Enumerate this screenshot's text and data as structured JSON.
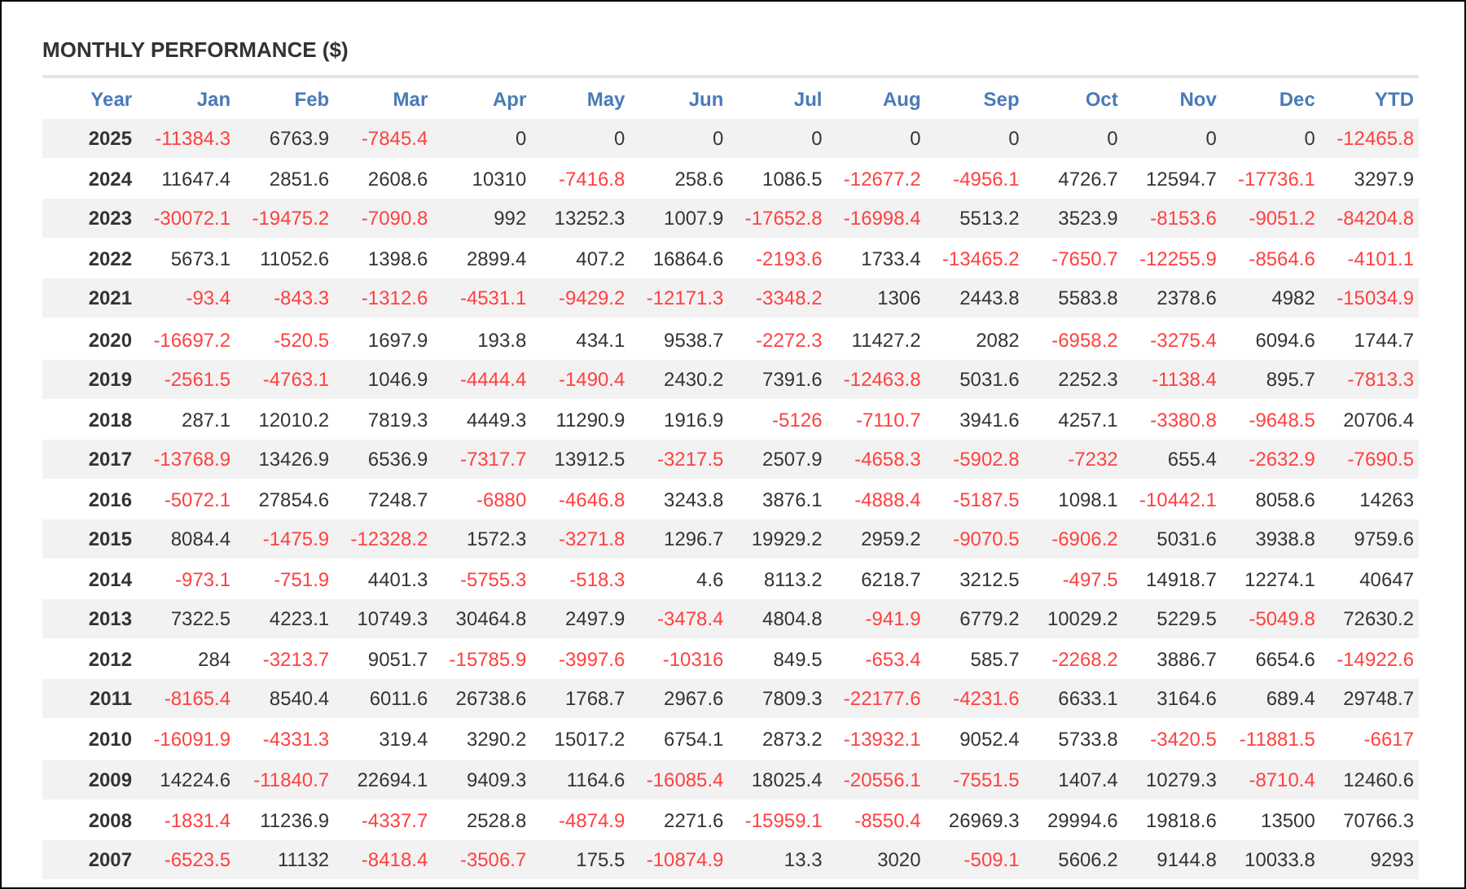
{
  "title": "MONTHLY PERFORMANCE ($)",
  "columns": [
    "Year",
    "Jan",
    "Feb",
    "Mar",
    "Apr",
    "May",
    "Jun",
    "Jul",
    "Aug",
    "Sep",
    "Oct",
    "Nov",
    "Dec",
    "YTD"
  ],
  "rows": [
    {
      "year": "2025",
      "cells": [
        {
          "text": "-11384.3",
          "loss": true
        },
        {
          "text": "6763.9",
          "loss": false
        },
        {
          "text": "-7845.4",
          "loss": true
        },
        {
          "text": "0",
          "loss": false
        },
        {
          "text": "0",
          "loss": false
        },
        {
          "text": "0",
          "loss": false
        },
        {
          "text": "0",
          "loss": false
        },
        {
          "text": "0",
          "loss": false
        },
        {
          "text": "0",
          "loss": false
        },
        {
          "text": "0",
          "loss": false
        },
        {
          "text": "0",
          "loss": false
        },
        {
          "text": "0",
          "loss": false
        },
        {
          "text": "-12465.8",
          "loss": true
        }
      ]
    },
    {
      "year": "2024",
      "cells": [
        {
          "text": "11647.4",
          "loss": false
        },
        {
          "text": "2851.6",
          "loss": false
        },
        {
          "text": "2608.6",
          "loss": false
        },
        {
          "text": "10310",
          "loss": false
        },
        {
          "text": "-7416.8",
          "loss": true
        },
        {
          "text": "258.6",
          "loss": false
        },
        {
          "text": "1086.5",
          "loss": false
        },
        {
          "text": "-12677.2",
          "loss": true
        },
        {
          "text": "-4956.1",
          "loss": true
        },
        {
          "text": "4726.7",
          "loss": false
        },
        {
          "text": "12594.7",
          "loss": false
        },
        {
          "text": "-17736.1",
          "loss": true
        },
        {
          "text": "3297.9",
          "loss": false
        }
      ]
    },
    {
      "year": "2023",
      "cells": [
        {
          "text": "-30072.1",
          "loss": true
        },
        {
          "text": "-19475.2",
          "loss": true
        },
        {
          "text": "-7090.8",
          "loss": true
        },
        {
          "text": "992",
          "loss": false
        },
        {
          "text": "13252.3",
          "loss": false
        },
        {
          "text": "1007.9",
          "loss": false
        },
        {
          "text": "-17652.8",
          "loss": true
        },
        {
          "text": "-16998.4",
          "loss": true
        },
        {
          "text": "5513.2",
          "loss": false
        },
        {
          "text": "3523.9",
          "loss": false
        },
        {
          "text": "-8153.6",
          "loss": true
        },
        {
          "text": "-9051.2",
          "loss": true
        },
        {
          "text": "-84204.8",
          "loss": true
        }
      ]
    },
    {
      "year": "2022",
      "cells": [
        {
          "text": "5673.1",
          "loss": false
        },
        {
          "text": "11052.6",
          "loss": false
        },
        {
          "text": "1398.6",
          "loss": false
        },
        {
          "text": "2899.4",
          "loss": false
        },
        {
          "text": "407.2",
          "loss": false
        },
        {
          "text": "16864.6",
          "loss": false
        },
        {
          "text": "-2193.6",
          "loss": true
        },
        {
          "text": "1733.4",
          "loss": false
        },
        {
          "text": "-13465.2",
          "loss": true
        },
        {
          "text": "-7650.7",
          "loss": true
        },
        {
          "text": "-12255.9",
          "loss": true
        },
        {
          "text": "-8564.6",
          "loss": true
        },
        {
          "text": "-4101.1",
          "loss": true
        }
      ]
    },
    {
      "year": "2021",
      "cells": [
        {
          "text": "-93.4",
          "loss": true
        },
        {
          "text": "-843.3",
          "loss": true
        },
        {
          "text": "-1312.6",
          "loss": true
        },
        {
          "text": "-4531.1",
          "loss": true
        },
        {
          "text": "-9429.2",
          "loss": true
        },
        {
          "text": "-12171.3",
          "loss": true
        },
        {
          "text": "-3348.2",
          "loss": true
        },
        {
          "text": "1306",
          "loss": false
        },
        {
          "text": "2443.8",
          "loss": false
        },
        {
          "text": "5583.8",
          "loss": false
        },
        {
          "text": "2378.6",
          "loss": false
        },
        {
          "text": "4982",
          "loss": false
        },
        {
          "text": "-15034.9",
          "loss": true
        }
      ]
    },
    {
      "year": "2020",
      "cells": [
        {
          "text": "-16697.2",
          "loss": true
        },
        {
          "text": "-520.5",
          "loss": true
        },
        {
          "text": "1697.9",
          "loss": false
        },
        {
          "text": "193.8",
          "loss": false
        },
        {
          "text": "434.1",
          "loss": false
        },
        {
          "text": "9538.7",
          "loss": false
        },
        {
          "text": "-2272.3",
          "loss": true
        },
        {
          "text": "11427.2",
          "loss": false
        },
        {
          "text": "2082",
          "loss": false
        },
        {
          "text": "-6958.2",
          "loss": true
        },
        {
          "text": "-3275.4",
          "loss": true
        },
        {
          "text": "6094.6",
          "loss": false
        },
        {
          "text": "1744.7",
          "loss": false
        }
      ]
    },
    {
      "year": "2019",
      "cells": [
        {
          "text": "-2561.5",
          "loss": true
        },
        {
          "text": "-4763.1",
          "loss": true
        },
        {
          "text": "1046.9",
          "loss": false
        },
        {
          "text": "-4444.4",
          "loss": true
        },
        {
          "text": "-1490.4",
          "loss": true
        },
        {
          "text": "2430.2",
          "loss": false
        },
        {
          "text": "7391.6",
          "loss": false
        },
        {
          "text": "-12463.8",
          "loss": true
        },
        {
          "text": "5031.6",
          "loss": false
        },
        {
          "text": "2252.3",
          "loss": false
        },
        {
          "text": "-1138.4",
          "loss": true
        },
        {
          "text": "895.7",
          "loss": false
        },
        {
          "text": "-7813.3",
          "loss": true
        }
      ]
    },
    {
      "year": "2018",
      "cells": [
        {
          "text": "287.1",
          "loss": false
        },
        {
          "text": "12010.2",
          "loss": false
        },
        {
          "text": "7819.3",
          "loss": false
        },
        {
          "text": "4449.3",
          "loss": false
        },
        {
          "text": "11290.9",
          "loss": false
        },
        {
          "text": "1916.9",
          "loss": false
        },
        {
          "text": "-5126",
          "loss": true
        },
        {
          "text": "-7110.7",
          "loss": true
        },
        {
          "text": "3941.6",
          "loss": false
        },
        {
          "text": "4257.1",
          "loss": false
        },
        {
          "text": "-3380.8",
          "loss": true
        },
        {
          "text": "-9648.5",
          "loss": true
        },
        {
          "text": "20706.4",
          "loss": false
        }
      ]
    },
    {
      "year": "2017",
      "cells": [
        {
          "text": "-13768.9",
          "loss": true
        },
        {
          "text": "13426.9",
          "loss": false
        },
        {
          "text": "6536.9",
          "loss": false
        },
        {
          "text": "-7317.7",
          "loss": true
        },
        {
          "text": "13912.5",
          "loss": false
        },
        {
          "text": "-3217.5",
          "loss": true
        },
        {
          "text": "2507.9",
          "loss": false
        },
        {
          "text": "-4658.3",
          "loss": true
        },
        {
          "text": "-5902.8",
          "loss": true
        },
        {
          "text": "-7232",
          "loss": true
        },
        {
          "text": "655.4",
          "loss": false
        },
        {
          "text": "-2632.9",
          "loss": true
        },
        {
          "text": "-7690.5",
          "loss": true
        }
      ]
    },
    {
      "year": "2016",
      "cells": [
        {
          "text": "-5072.1",
          "loss": true
        },
        {
          "text": "27854.6",
          "loss": false
        },
        {
          "text": "7248.7",
          "loss": false
        },
        {
          "text": "-6880",
          "loss": true
        },
        {
          "text": "-4646.8",
          "loss": true
        },
        {
          "text": "3243.8",
          "loss": false
        },
        {
          "text": "3876.1",
          "loss": false
        },
        {
          "text": "-4888.4",
          "loss": true
        },
        {
          "text": "-5187.5",
          "loss": true
        },
        {
          "text": "1098.1",
          "loss": false
        },
        {
          "text": "-10442.1",
          "loss": true
        },
        {
          "text": "8058.6",
          "loss": false
        },
        {
          "text": "14263",
          "loss": false
        }
      ]
    },
    {
      "year": "2015",
      "cells": [
        {
          "text": "8084.4",
          "loss": false
        },
        {
          "text": "-1475.9",
          "loss": true
        },
        {
          "text": "-12328.2",
          "loss": true
        },
        {
          "text": "1572.3",
          "loss": false
        },
        {
          "text": "-3271.8",
          "loss": true
        },
        {
          "text": "1296.7",
          "loss": false
        },
        {
          "text": "19929.2",
          "loss": false
        },
        {
          "text": "2959.2",
          "loss": false
        },
        {
          "text": "-9070.5",
          "loss": true
        },
        {
          "text": "-6906.2",
          "loss": true
        },
        {
          "text": "5031.6",
          "loss": false
        },
        {
          "text": "3938.8",
          "loss": false
        },
        {
          "text": "9759.6",
          "loss": false
        }
      ]
    },
    {
      "year": "2014",
      "cells": [
        {
          "text": "-973.1",
          "loss": true
        },
        {
          "text": "-751.9",
          "loss": true
        },
        {
          "text": "4401.3",
          "loss": false
        },
        {
          "text": "-5755.3",
          "loss": true
        },
        {
          "text": "-518.3",
          "loss": true
        },
        {
          "text": "4.6",
          "loss": false
        },
        {
          "text": "8113.2",
          "loss": false
        },
        {
          "text": "6218.7",
          "loss": false
        },
        {
          "text": "3212.5",
          "loss": false
        },
        {
          "text": "-497.5",
          "loss": true
        },
        {
          "text": "14918.7",
          "loss": false
        },
        {
          "text": "12274.1",
          "loss": false
        },
        {
          "text": "40647",
          "loss": false
        }
      ]
    },
    {
      "year": "2013",
      "cells": [
        {
          "text": "7322.5",
          "loss": false
        },
        {
          "text": "4223.1",
          "loss": false
        },
        {
          "text": "10749.3",
          "loss": false
        },
        {
          "text": "30464.8",
          "loss": false
        },
        {
          "text": "2497.9",
          "loss": false
        },
        {
          "text": "-3478.4",
          "loss": true
        },
        {
          "text": "4804.8",
          "loss": false
        },
        {
          "text": "-941.9",
          "loss": true
        },
        {
          "text": "6779.2",
          "loss": false
        },
        {
          "text": "10029.2",
          "loss": false
        },
        {
          "text": "5229.5",
          "loss": false
        },
        {
          "text": "-5049.8",
          "loss": true
        },
        {
          "text": "72630.2",
          "loss": false
        }
      ]
    },
    {
      "year": "2012",
      "cells": [
        {
          "text": "284",
          "loss": false
        },
        {
          "text": "-3213.7",
          "loss": true
        },
        {
          "text": "9051.7",
          "loss": false
        },
        {
          "text": "-15785.9",
          "loss": true
        },
        {
          "text": "-3997.6",
          "loss": true
        },
        {
          "text": "-10316",
          "loss": true
        },
        {
          "text": "849.5",
          "loss": false
        },
        {
          "text": "-653.4",
          "loss": true
        },
        {
          "text": "585.7",
          "loss": false
        },
        {
          "text": "-2268.2",
          "loss": true
        },
        {
          "text": "3886.7",
          "loss": false
        },
        {
          "text": "6654.6",
          "loss": false
        },
        {
          "text": "-14922.6",
          "loss": true
        }
      ]
    },
    {
      "year": "2011",
      "cells": [
        {
          "text": "-8165.4",
          "loss": true
        },
        {
          "text": "8540.4",
          "loss": false
        },
        {
          "text": "6011.6",
          "loss": false
        },
        {
          "text": "26738.6",
          "loss": false
        },
        {
          "text": "1768.7",
          "loss": false
        },
        {
          "text": "2967.6",
          "loss": false
        },
        {
          "text": "7809.3",
          "loss": false
        },
        {
          "text": "-22177.6",
          "loss": true
        },
        {
          "text": "-4231.6",
          "loss": true
        },
        {
          "text": "6633.1",
          "loss": false
        },
        {
          "text": "3164.6",
          "loss": false
        },
        {
          "text": "689.4",
          "loss": false
        },
        {
          "text": "29748.7",
          "loss": false
        }
      ]
    },
    {
      "year": "2010",
      "cells": [
        {
          "text": "-16091.9",
          "loss": true
        },
        {
          "text": "-4331.3",
          "loss": true
        },
        {
          "text": "319.4",
          "loss": false
        },
        {
          "text": "3290.2",
          "loss": false
        },
        {
          "text": "15017.2",
          "loss": false
        },
        {
          "text": "6754.1",
          "loss": false
        },
        {
          "text": "2873.2",
          "loss": false
        },
        {
          "text": "-13932.1",
          "loss": true
        },
        {
          "text": "9052.4",
          "loss": false
        },
        {
          "text": "5733.8",
          "loss": false
        },
        {
          "text": "-3420.5",
          "loss": true
        },
        {
          "text": "-11881.5",
          "loss": true
        },
        {
          "text": "-6617",
          "loss": true
        }
      ]
    },
    {
      "year": "2009",
      "cells": [
        {
          "text": "14224.6",
          "loss": false
        },
        {
          "text": "-11840.7",
          "loss": true
        },
        {
          "text": "22694.1",
          "loss": false
        },
        {
          "text": "9409.3",
          "loss": false
        },
        {
          "text": "1164.6",
          "loss": false
        },
        {
          "text": "-16085.4",
          "loss": true
        },
        {
          "text": "18025.4",
          "loss": false
        },
        {
          "text": "-20556.1",
          "loss": true
        },
        {
          "text": "-7551.5",
          "loss": true
        },
        {
          "text": "1407.4",
          "loss": false
        },
        {
          "text": "10279.3",
          "loss": false
        },
        {
          "text": "-8710.4",
          "loss": true
        },
        {
          "text": "12460.6",
          "loss": false
        }
      ]
    },
    {
      "year": "2008",
      "cells": [
        {
          "text": "-1831.4",
          "loss": true
        },
        {
          "text": "11236.9",
          "loss": false
        },
        {
          "text": "-4337.7",
          "loss": true
        },
        {
          "text": "2528.8",
          "loss": false
        },
        {
          "text": "-4874.9",
          "loss": true
        },
        {
          "text": "2271.6",
          "loss": false
        },
        {
          "text": "-15959.1",
          "loss": true
        },
        {
          "text": "-8550.4",
          "loss": true
        },
        {
          "text": "26969.3",
          "loss": false
        },
        {
          "text": "29994.6",
          "loss": false
        },
        {
          "text": "19818.6",
          "loss": false
        },
        {
          "text": "13500",
          "loss": false
        },
        {
          "text": "70766.3",
          "loss": false
        }
      ]
    },
    {
      "year": "2007",
      "cells": [
        {
          "text": "-6523.5",
          "loss": true
        },
        {
          "text": "11132",
          "loss": false
        },
        {
          "text": "-8418.4",
          "loss": true
        },
        {
          "text": "-3506.7",
          "loss": true
        },
        {
          "text": "175.5",
          "loss": false
        },
        {
          "text": "-10874.9",
          "loss": true
        },
        {
          "text": "13.3",
          "loss": false
        },
        {
          "text": "3020",
          "loss": false
        },
        {
          "text": "-509.1",
          "loss": true
        },
        {
          "text": "5606.2",
          "loss": false
        },
        {
          "text": "9144.8",
          "loss": false
        },
        {
          "text": "10033.8",
          "loss": false
        },
        {
          "text": "9293",
          "loss": false
        }
      ]
    }
  ]
}
